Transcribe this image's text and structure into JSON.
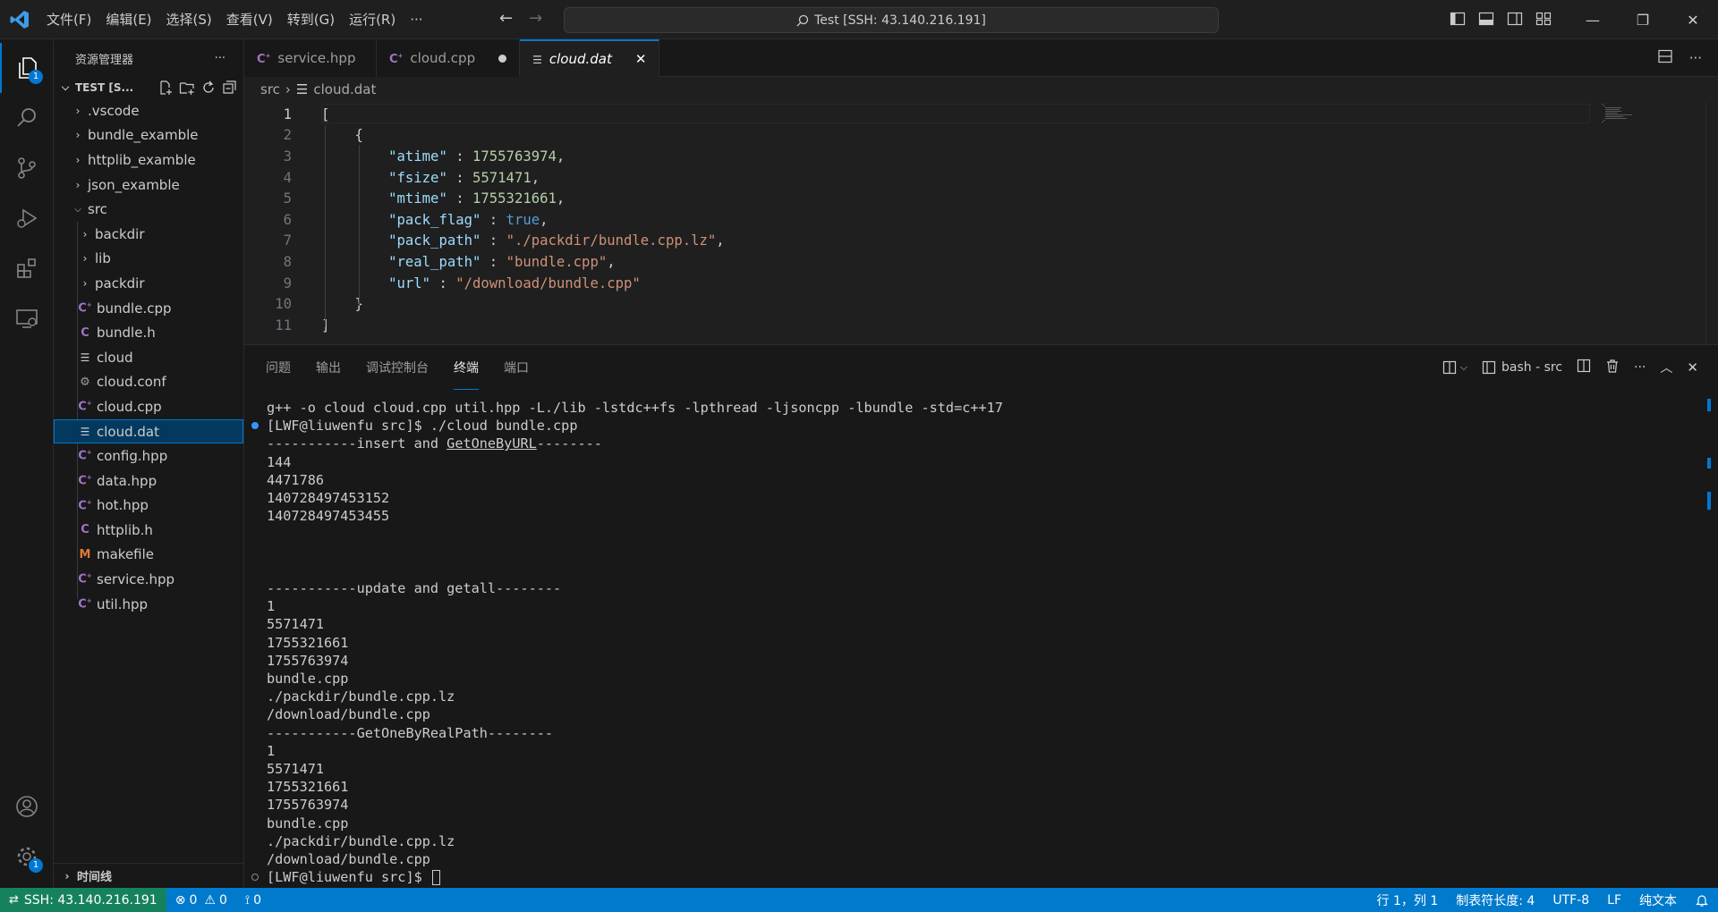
{
  "titlebar": {
    "menu": [
      "文件(F)",
      "编辑(E)",
      "选择(S)",
      "查看(V)",
      "转到(G)",
      "运行(R)",
      "···"
    ],
    "command_center": "Test [SSH: 43.140.216.191]"
  },
  "activitybar": {
    "explorer_badge": "1",
    "settings_badge": "1"
  },
  "sidebar": {
    "title": "资源管理器",
    "more": "···",
    "workspace": "TEST [S...",
    "tree": [
      {
        "label": ".vscode",
        "type": "folder",
        "depth": 0
      },
      {
        "label": "bundle_examble",
        "type": "folder",
        "depth": 0
      },
      {
        "label": "httplib_examble",
        "type": "folder",
        "depth": 0
      },
      {
        "label": "json_examble",
        "type": "folder",
        "depth": 0
      },
      {
        "label": "src",
        "type": "folder-open",
        "depth": 0
      },
      {
        "label": "backdir",
        "type": "folder",
        "depth": 1
      },
      {
        "label": "lib",
        "type": "folder",
        "depth": 1
      },
      {
        "label": "packdir",
        "type": "folder",
        "depth": 1
      },
      {
        "label": "bundle.cpp",
        "type": "cpp",
        "depth": 1
      },
      {
        "label": "bundle.h",
        "type": "c",
        "depth": 1
      },
      {
        "label": "cloud",
        "type": "text",
        "depth": 1
      },
      {
        "label": "cloud.conf",
        "type": "gear",
        "depth": 1
      },
      {
        "label": "cloud.cpp",
        "type": "cpp",
        "depth": 1
      },
      {
        "label": "cloud.dat",
        "type": "text",
        "depth": 1,
        "selected": true
      },
      {
        "label": "config.hpp",
        "type": "cpp",
        "depth": 1
      },
      {
        "label": "data.hpp",
        "type": "cpp",
        "depth": 1
      },
      {
        "label": "hot.hpp",
        "type": "cpp",
        "depth": 1
      },
      {
        "label": "httplib.h",
        "type": "c",
        "depth": 1
      },
      {
        "label": "makefile",
        "type": "make",
        "depth": 1
      },
      {
        "label": "service.hpp",
        "type": "cpp",
        "depth": 1
      },
      {
        "label": "util.hpp",
        "type": "cpp",
        "depth": 1
      }
    ],
    "timeline": "时间线"
  },
  "tabs": [
    {
      "label": "service.hpp",
      "type": "cpp",
      "active": false
    },
    {
      "label": "cloud.cpp",
      "type": "cpp",
      "active": false,
      "modified": true
    },
    {
      "label": "cloud.dat",
      "type": "text",
      "active": true
    }
  ],
  "breadcrumb": {
    "folder": "src",
    "file": "cloud.dat"
  },
  "editor": {
    "lines": [
      "[",
      "    {",
      "        \"atime\" : 1755763974,",
      "        \"fsize\" : 5571471,",
      "        \"mtime\" : 1755321661,",
      "        \"pack_flag\" : true,",
      "        \"pack_path\" : \"./packdir/bundle.cpp.lz\",",
      "        \"real_path\" : \"bundle.cpp\",",
      "        \"url\" : \"/download/bundle.cpp\"",
      "    }",
      "]"
    ],
    "current_line": 1
  },
  "panel": {
    "tabs": [
      "问题",
      "输出",
      "调试控制台",
      "终端",
      "端口"
    ],
    "active_tab": "终端",
    "terminal_name": "bash - src"
  },
  "terminal": {
    "lines": [
      "g++ -o cloud cloud.cpp util.hpp -L./lib -lstdc++fs -lpthread -ljsoncpp -lbundle -std=c++17",
      "[LWF@liuwenfu src]$ ./cloud bundle.cpp",
      "-----------insert and GetOneByURL--------",
      "144",
      "4471786",
      "140728497453152",
      "140728497453455",
      "",
      "",
      "",
      "-----------update and getall--------",
      "1",
      "5571471",
      "1755321661",
      "1755763974",
      "bundle.cpp",
      "./packdir/bundle.cpp.lz",
      "/download/bundle.cpp",
      "-----------GetOneByRealPath--------",
      "1",
      "5571471",
      "1755321661",
      "1755763974",
      "bundle.cpp",
      "./packdir/bundle.cpp.lz",
      "/download/bundle.cpp",
      "[LWF@liuwenfu src]$ "
    ],
    "underlined_text": "GetOneByURL"
  },
  "statusbar": {
    "remote": "SSH: 43.140.216.191",
    "errors": "0",
    "warnings": "0",
    "ports": "0",
    "position": "行 1，列 1",
    "indent": "制表符长度: 4",
    "encoding": "UTF-8",
    "eol": "LF",
    "language": "纯文本"
  },
  "colors": {
    "accent": "#0078d4",
    "statusbar": "#007acc",
    "remote": "#16825d",
    "cpp_icon": "#a074c4",
    "makefile_icon": "#e37933"
  }
}
